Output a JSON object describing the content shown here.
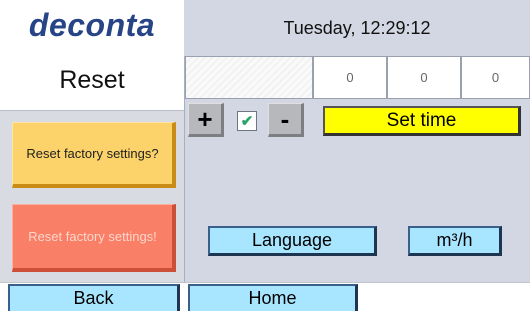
{
  "header": {
    "brand": "deconta",
    "screen_title": "Reset",
    "datetime": "Tuesday, 12:29:12"
  },
  "counters": {
    "values": [
      "0",
      "0",
      "0"
    ]
  },
  "time_controls": {
    "plus_label": "+",
    "minus_label": "-",
    "checkbox_checked": true,
    "checkbox_mark": "✔",
    "set_time_label": "Set time"
  },
  "reset": {
    "confirm_label": "Reset factory settings?",
    "execute_label": "Reset factory settings!"
  },
  "settings": {
    "language_label": "Language",
    "units_label": "m³/h"
  },
  "nav": {
    "back_label": "Back",
    "home_label": "Home"
  },
  "colors": {
    "brand": "#274487",
    "set_time_button": "#ffff00",
    "confirm_button": "#fcd36a",
    "execute_button": "#f97f66",
    "nav_buttons": "#a8e6ff"
  }
}
